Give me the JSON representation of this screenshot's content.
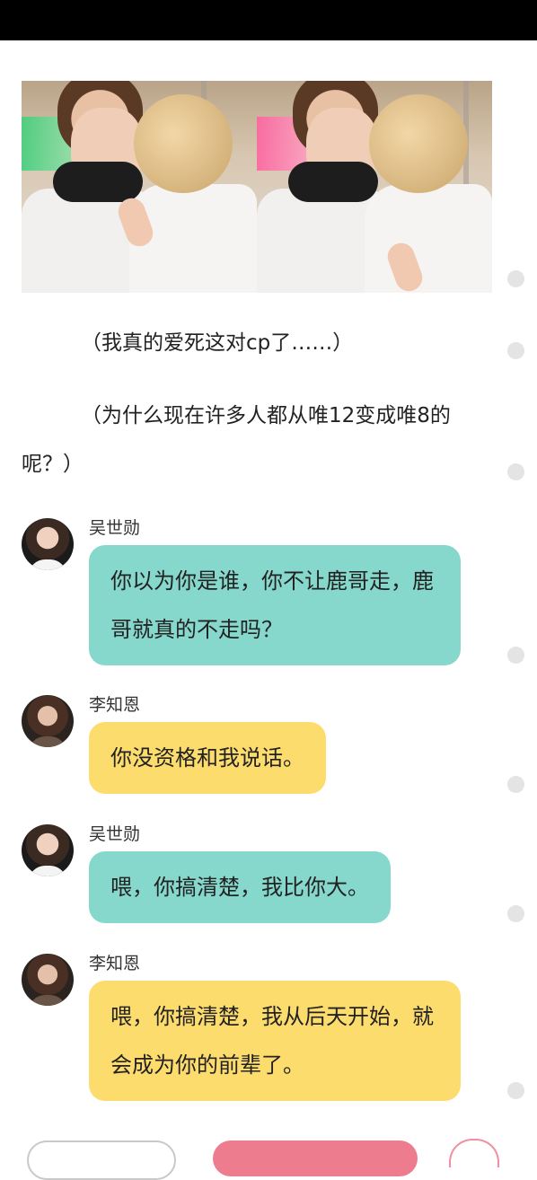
{
  "narration": [
    "（我真的爱死这对cp了……）",
    "（为什么现在许多人都从唯12变成唯8的呢？）"
  ],
  "messages": [
    {
      "sender": "吴世勋",
      "text": "你以为你是谁，你不让鹿哥走，鹿哥就真的不走吗？",
      "color": "#86d7cc"
    },
    {
      "sender": "李知恩",
      "text": "你没资格和我说话。",
      "color": "#fddc6e"
    },
    {
      "sender": "吴世勋",
      "text": "喂，你搞清楚，我比你大。",
      "color": "#86d7cc"
    },
    {
      "sender": "李知恩",
      "text": "喂，你搞清楚，我从后天开始，就会成为你的前辈了。",
      "color": "#fddc6e"
    }
  ],
  "icons": {
    "scroll_dot": "circle-dot-icon",
    "bottom_right": "heart-badge-icon"
  }
}
